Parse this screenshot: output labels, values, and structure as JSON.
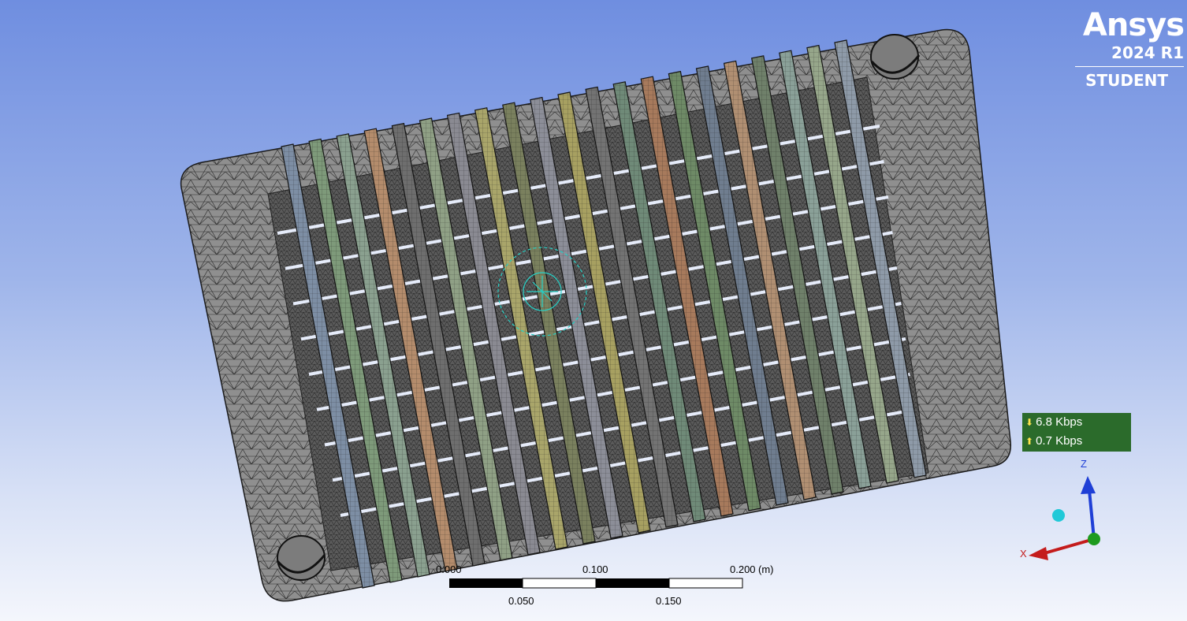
{
  "branding": {
    "brand": "Ansys",
    "version": "2024 R1",
    "edition": "STUDENT"
  },
  "network": {
    "download": "6.8 Kbps",
    "upload": "0.7 Kbps",
    "down_icon": "arrow-down-icon",
    "up_icon": "arrow-up-icon"
  },
  "scale_bar": {
    "top_labels": [
      "0.000",
      "0.100",
      "0.200"
    ],
    "unit": "(m)",
    "bottom_labels": [
      "0.050",
      "0.150"
    ]
  },
  "triad": {
    "z": "Z",
    "x": "X"
  },
  "colors": {
    "background_top": "#6f8ee0",
    "background_bottom": "#f4f6fc",
    "plate": "#8c8c8c",
    "network_bg": "#2b6b2b",
    "axis_z": "#1f3fd6",
    "axis_x": "#c41c1c",
    "axis_y": "#1e9b1e",
    "fins": [
      "#7d8ea4",
      "#7e9a7a",
      "#8aa08f",
      "#b48c6c",
      "#6e6e6e",
      "#8fa085",
      "#8a8a92",
      "#a9a56a",
      "#7a805e",
      "#8c8e98",
      "#a7a061",
      "#737373",
      "#6f8a78",
      "#a77a5c",
      "#6e8a66",
      "#6f7d8f",
      "#b08f72",
      "#6f806a",
      "#8aa098",
      "#96a68a",
      "#8e9aa8"
    ]
  }
}
